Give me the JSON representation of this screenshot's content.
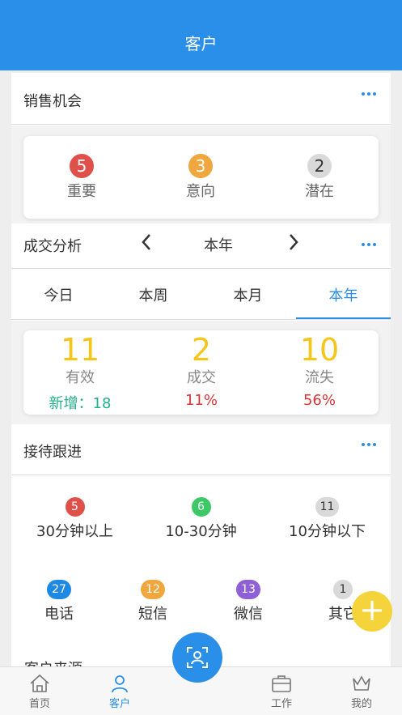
{
  "header": {
    "title": "客户"
  },
  "sales": {
    "title": "销售机会",
    "items": [
      {
        "count": "5",
        "label": "重要",
        "color": "#e0504a"
      },
      {
        "count": "3",
        "label": "意向",
        "color": "#f0a73d"
      },
      {
        "count": "2",
        "label": "潜在",
        "color": "#d9d9d9"
      }
    ]
  },
  "analysis": {
    "title": "成交分析",
    "period": "本年",
    "tabs": [
      "今日",
      "本周",
      "本月",
      "本年"
    ],
    "active_tab": "本年",
    "stats": [
      {
        "value": "11",
        "label": "有效",
        "extra": "新增：18",
        "extra_color": "#20b08a"
      },
      {
        "value": "2",
        "label": "成交",
        "extra": "11%",
        "extra_color": "#d93535"
      },
      {
        "value": "10",
        "label": "流失",
        "extra": "56%",
        "extra_color": "#d93535"
      }
    ]
  },
  "follow": {
    "title": "接待跟进",
    "time": [
      {
        "count": "5",
        "label": "30分钟以上",
        "color": "#e0504a"
      },
      {
        "count": "6",
        "label": "10-30分钟",
        "color": "#3cc866"
      },
      {
        "count": "11",
        "label": "10分钟以下",
        "color": "#d9d9d9"
      }
    ],
    "channel": [
      {
        "count": "27",
        "label": "电话",
        "color": "#1e88e5"
      },
      {
        "count": "12",
        "label": "短信",
        "color": "#f0a73d"
      },
      {
        "count": "13",
        "label": "微信",
        "color": "#8e5fd6"
      },
      {
        "count": "1",
        "label": "其它",
        "color": "#d9d9d9"
      }
    ]
  },
  "next_section": {
    "title": "客户来源"
  },
  "tabbar": {
    "items": [
      {
        "label": "首页",
        "icon": "home-icon"
      },
      {
        "label": "客户",
        "icon": "user-icon"
      },
      {
        "label": "",
        "icon": "face-scan-icon"
      },
      {
        "label": "工作",
        "icon": "briefcase-icon"
      },
      {
        "label": "我的",
        "icon": "crown-icon"
      }
    ]
  }
}
